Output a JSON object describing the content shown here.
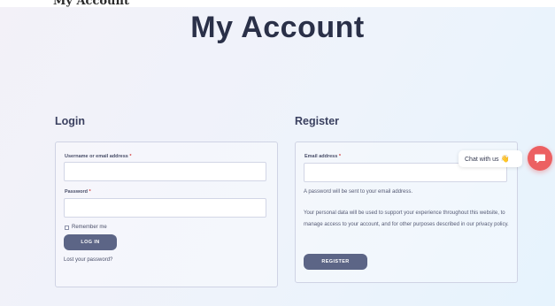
{
  "page": {
    "top_strip_text": "My Account",
    "title": "My Account"
  },
  "login": {
    "heading": "Login",
    "username_label": "Username or email address",
    "password_label": "Password",
    "required_mark": "*",
    "remember_label": "Remember me",
    "remember_checked": false,
    "submit_label": "LOG IN",
    "lost_password_link": "Lost your password?"
  },
  "register": {
    "heading": "Register",
    "email_label": "Email address",
    "required_mark": "*",
    "password_note": "A password will be sent to your email address.",
    "privacy_note": "Your personal data will be used to support your experience throughout this website, to manage access to your account, and for other purposes described in our privacy policy.",
    "submit_label": "REGISTER"
  },
  "chat": {
    "bubble_text": "Chat with us",
    "bubble_emoji": "👋",
    "launcher_icon": "chat-icon",
    "launcher_color": "#ec6062"
  },
  "colors": {
    "button": "#5c6586",
    "required": "#d23b3b",
    "title": "#2a3048"
  }
}
